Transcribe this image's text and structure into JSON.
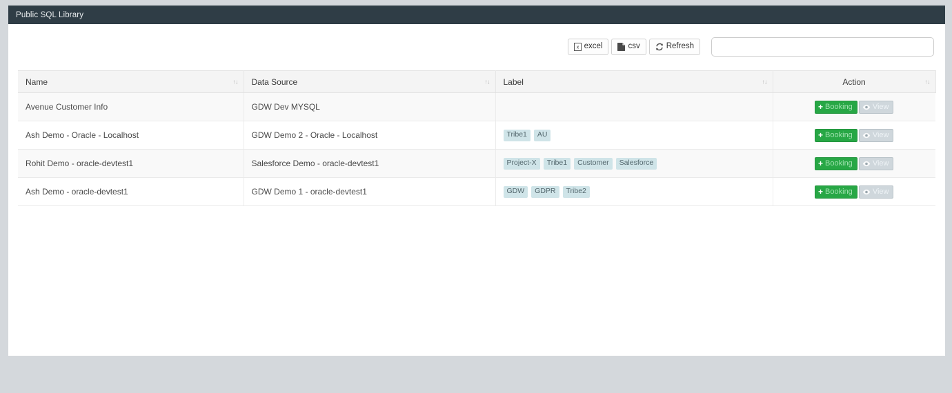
{
  "panel": {
    "title": "Public SQL Library"
  },
  "toolbar": {
    "excel_label": "excel",
    "csv_label": "csv",
    "refresh_label": "Refresh",
    "excel_icon": "file-excel-icon",
    "csv_icon": "file-csv-icon",
    "refresh_icon": "refresh-icon",
    "search_value": "",
    "search_placeholder": ""
  },
  "table": {
    "columns": [
      {
        "key": "name",
        "label": "Name",
        "align": "left",
        "sortable": true
      },
      {
        "key": "data_source",
        "label": "Data Source",
        "align": "left",
        "sortable": true
      },
      {
        "key": "label",
        "label": "Label",
        "align": "left",
        "sortable": true
      },
      {
        "key": "action",
        "label": "Action",
        "align": "center",
        "sortable": true
      }
    ],
    "sort_icon": "sort-updown-icon",
    "rows": [
      {
        "name": "Avenue Customer Info",
        "data_source": "GDW Dev MYSQL",
        "labels": [],
        "booking_label": "Booking",
        "view_label": "View"
      },
      {
        "name": "Ash Demo - Oracle - Localhost",
        "data_source": "GDW Demo 2 - Oracle - Localhost",
        "labels": [
          "Tribe1",
          "AU"
        ],
        "booking_label": "Booking",
        "view_label": "View"
      },
      {
        "name": "Rohit Demo - oracle-devtest1",
        "data_source": "Salesforce Demo - oracle-devtest1",
        "labels": [
          "Project-X",
          "Tribe1",
          "Customer",
          "Salesforce"
        ],
        "booking_label": "Booking",
        "view_label": "View"
      },
      {
        "name": "Ash Demo - oracle-devtest1",
        "data_source": "GDW Demo 1 - oracle-devtest1",
        "labels": [
          "GDW",
          "GDPR",
          "Tribe2"
        ],
        "booking_label": "Booking",
        "view_label": "View"
      }
    ]
  },
  "colors": {
    "header_bar": "#2f3d46",
    "page_background": "#d4d8dc",
    "tag_background": "#cfe4e8",
    "booking_green": "#27a745",
    "view_grey": "#cfd7dc"
  }
}
